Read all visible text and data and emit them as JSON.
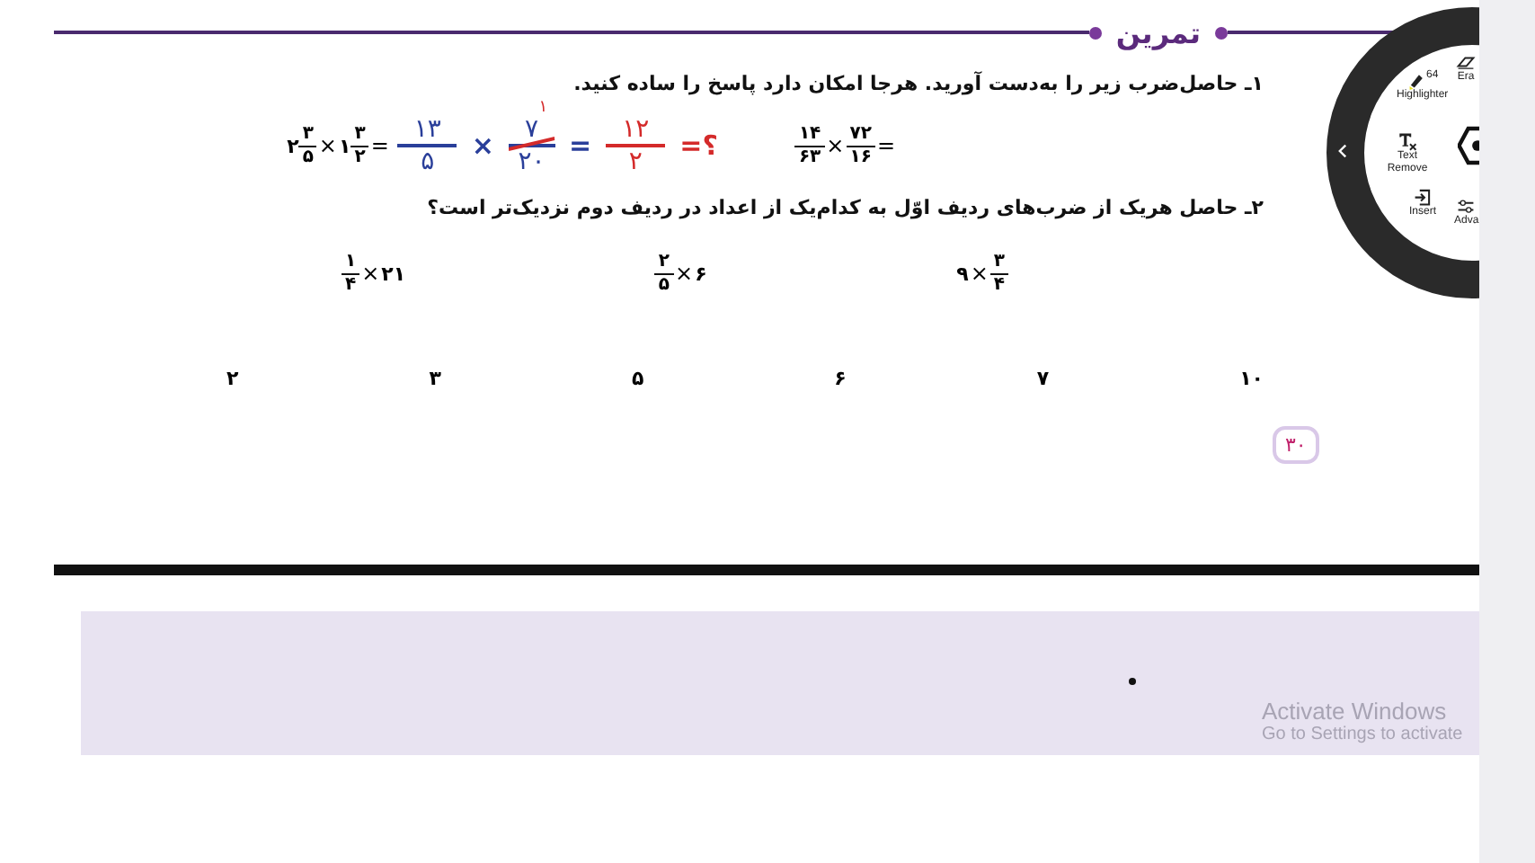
{
  "header": {
    "title": "تمرین"
  },
  "question_1": {
    "text": "۱ـ حاصل‌ضرب زیر را به‌دست آورید. هرجا امکان دارد پاسخ را ساده کنید.",
    "expression_a": {
      "left": {
        "kind": "frac",
        "num": "۱۴",
        "den": "۶۳"
      },
      "operator": "×",
      "right": {
        "kind": "frac",
        "num": "۷۲",
        "den": "۱۶"
      },
      "equals": "="
    },
    "expression_b": {
      "left": {
        "kind": "mixed",
        "whole": "۲",
        "num": "۳",
        "den": "۵"
      },
      "operator": "×",
      "right": {
        "kind": "mixed",
        "whole": "۱",
        "num": "۳",
        "den": "۲"
      },
      "equals": "=",
      "handwriting": {
        "first": {
          "num": "۱۳",
          "den": "۵",
          "color": "#2a3f9a"
        },
        "operator": {
          "text": "×",
          "color": "#2a3f9a"
        },
        "second": {
          "num": "۷",
          "den": "۲۰",
          "color": "#2a3f9a",
          "crossed": true,
          "note": "۱"
        },
        "equals": {
          "text": "=",
          "color": "#2a3f9a"
        },
        "result": {
          "num": "۱۲",
          "den": "۲",
          "color": "#d42a2a"
        },
        "ending": {
          "text": "=؟",
          "color": "#d42a2a"
        }
      }
    }
  },
  "question_2": {
    "text": "۲ـ حاصل هریک از ضرب‌های ردیف اوّل به کدام‌یک از اعداد در ردیف دوم نزدیک‌تر است؟",
    "product_right": {
      "left": {
        "kind": "number",
        "text": "۹"
      },
      "operator": "×",
      "right": {
        "kind": "frac",
        "num": "۳",
        "den": "۴"
      }
    },
    "product_middle": {
      "left": {
        "kind": "frac",
        "num": "۲",
        "den": "۵"
      },
      "operator": "×",
      "right": {
        "kind": "number",
        "text": "۶"
      }
    },
    "product_left": {
      "left": {
        "kind": "frac",
        "num": "۱",
        "den": "۴"
      },
      "operator": "×",
      "right": {
        "kind": "number",
        "text": "۲۱"
      }
    },
    "numbers": [
      "۱۰",
      "۷",
      "۶",
      "۵",
      "۳",
      "۲"
    ]
  },
  "page_number": "۳۰",
  "radial_menu": {
    "items": [
      {
        "kind": "highlighter",
        "label": "Highlighter",
        "badge": "64"
      },
      {
        "kind": "eraser",
        "label": "Era"
      },
      {
        "kind": "text-remove",
        "label": "Text Remove"
      },
      {
        "kind": "insert",
        "label": "Insert"
      },
      {
        "kind": "advanced",
        "label": "Adva"
      }
    ]
  },
  "activation_notice": {
    "title": "Activate Windows",
    "subtitle": "Go to Settings to activate"
  }
}
